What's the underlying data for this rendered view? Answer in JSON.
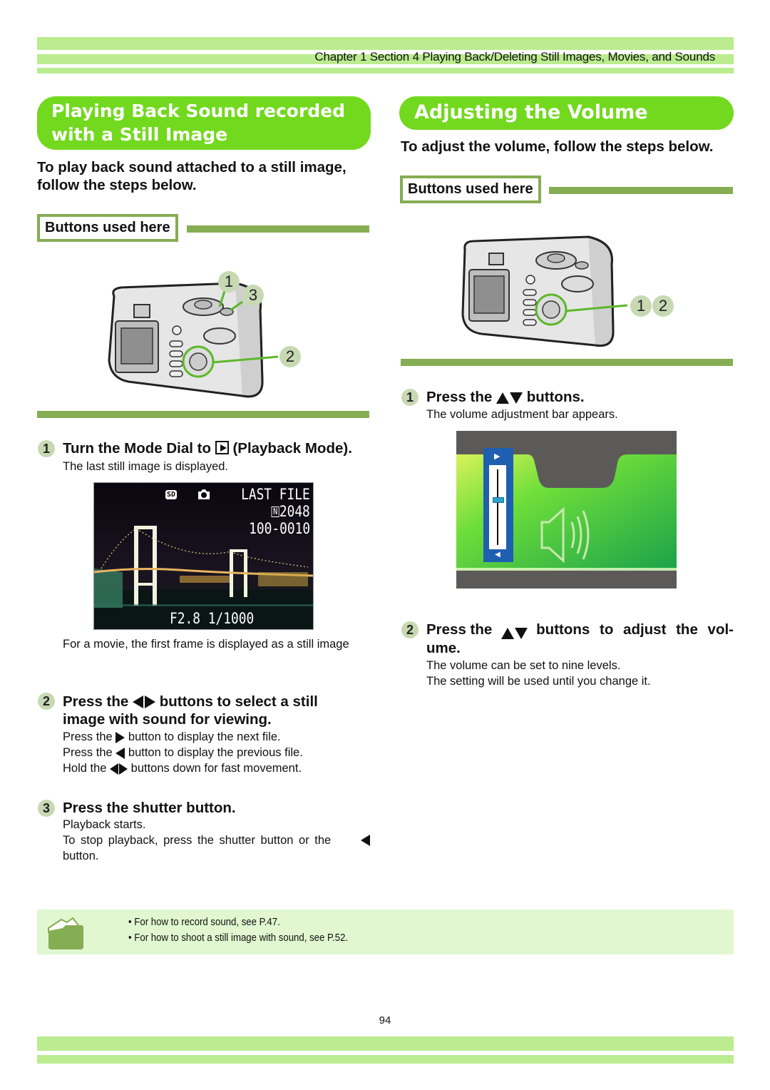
{
  "header": {
    "chapter_title": "Chapter 1 Section 4 Playing Back/Deleting Still Images, Movies, and Sounds"
  },
  "colors": {
    "band": "#bbec8f",
    "pill": "#72d91e",
    "accent_line": "#85ad53",
    "step_badge": "#c7d9b2",
    "note_bg": "#e1f7d0"
  },
  "left": {
    "section_title_line1": "Playing Back Sound recorded",
    "section_title_line2": "with a Still Image",
    "intro": "To play back sound attached to a still image, follow the steps below.",
    "buttons_used_label": "Buttons used here",
    "camera_callouts": [
      "1",
      "3",
      "2"
    ],
    "steps": [
      {
        "number": "1",
        "title_pre": "Turn the Mode Dial to",
        "title_icon": "playback-mode-icon",
        "title_post": "(Playback Mode).",
        "lines": [
          "The last still image is displayed."
        ]
      },
      {
        "number": "2",
        "title_pre": "Press the",
        "title_icon": "left-right-arrows-icon",
        "title_post": "buttons to select a still image with sound for viewing.",
        "lines": [
          {
            "pre": "Press the",
            "icon": "right-arrow-icon",
            "post": "button to display the next file."
          },
          {
            "pre": "Press the",
            "icon": "left-arrow-icon",
            "post": "button to display the previous file."
          },
          {
            "pre": "Hold the",
            "icon": "left-right-arrows-icon",
            "post": "buttons down for fast movement."
          }
        ]
      },
      {
        "number": "3",
        "title": "Press the shutter button.",
        "lines": [
          "Playback starts.",
          "To stop playback, press the shutter button or the",
          "button."
        ]
      }
    ],
    "lcd": {
      "label_sd": "SD",
      "last_file": "LAST FILE",
      "quality_badge": "N",
      "resolution": "2048",
      "file_number": "100-0010",
      "exposure": "F2.8 1/1000"
    },
    "movie_note": "For a movie, the first frame is displayed as a still image"
  },
  "right": {
    "section_title": "Adjusting the Volume",
    "intro": "To adjust the volume, follow the steps below.",
    "buttons_used_label": "Buttons used here",
    "camera_callouts": [
      "1",
      "2"
    ],
    "steps": [
      {
        "number": "1",
        "title_pre": "Press the",
        "title_icon": "up-down-arrows-icon",
        "title_post": "buttons.",
        "lines": [
          "The volume adjustment bar appears."
        ]
      },
      {
        "number": "2",
        "title_pre": "Press the",
        "title_icon": "up-down-arrows-icon",
        "title_post": "buttons to adjust the vol-",
        "title_line2": "ume.",
        "lines": [
          "The volume can be set to nine levels.",
          "The setting will be used until you change it."
        ]
      }
    ],
    "volume_screen": {
      "levels": 9,
      "current_level_fraction": 0.6
    }
  },
  "note": {
    "icon": "folder-memo-icon",
    "items": [
      "For how to record sound, see P.47.",
      "For how to shoot a still image with sound, see P.52."
    ]
  },
  "footer": {
    "page_number": "94"
  }
}
